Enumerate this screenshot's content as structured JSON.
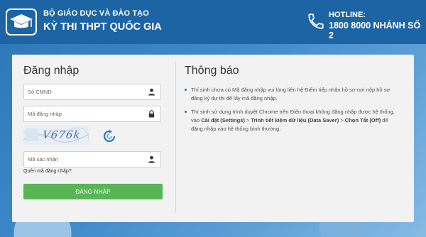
{
  "header": {
    "org": "BỘ GIÁO DỤC VÀ ĐÀO TẠO",
    "exam": "KỲ THI THPT QUỐC GIA",
    "hotline_label": "HOTLINE:",
    "hotline_number": "1800 8000 NHÁNH SỐ 2"
  },
  "login": {
    "title": "Đăng nhập",
    "id_placeholder": "Số CMND",
    "password_placeholder": "Mã đăng nhập",
    "captcha_text": "V676k",
    "captcha_placeholder": "Mã xác nhận",
    "forgot": "Quên mã đăng nhập?",
    "button": "ĐĂNG NHẬP"
  },
  "notice": {
    "title": "Thông báo",
    "item1": "Thí sinh chưa có Mã đăng nhập vui lòng liên hệ Điểm tiếp nhận hồ sơ nơi nộp hồ sơ đăng ký dự thi để lấy mã đăng nhập.",
    "item2_pre": "Thí sinh sử dụng trình duyệt Chrome trên Điện thoại không đăng nhập được hệ thống, vào ",
    "item2_b1": "Cài đặt (Settings)",
    "item2_s1": " > ",
    "item2_b2": "Trình tiết kiệm dữ liệu (Data Saver)",
    "item2_s2": " > ",
    "item2_b3": "Chọn Tắt (Off)",
    "item2_post": " để đăng nhập vào hệ thống bình thường."
  },
  "colors": {
    "header_bg": "#1d64a5",
    "button_bg": "#58b655",
    "card_bg": "#f2f2f2"
  },
  "icons": [
    "graduation-cap-icon",
    "phone-icon",
    "user-icon",
    "lock-icon",
    "refresh-icon"
  ]
}
